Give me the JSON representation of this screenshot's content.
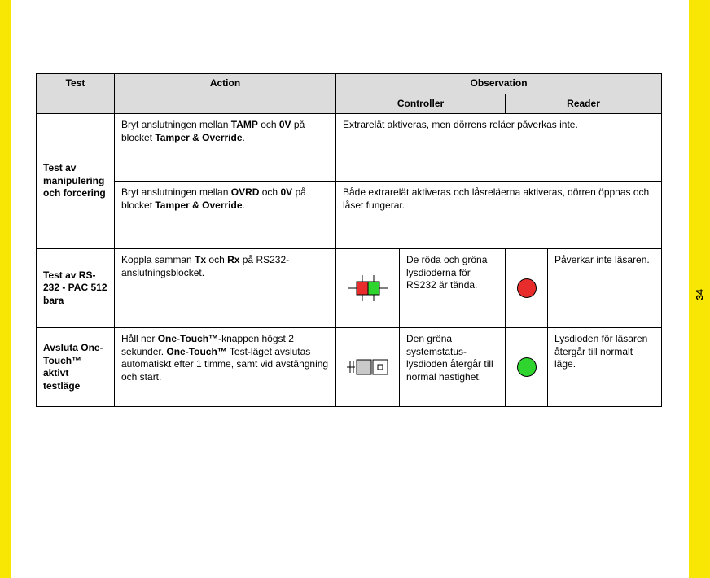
{
  "pageNumber": "34",
  "headers": {
    "test": "Test",
    "action": "Action",
    "observation": "Observation",
    "controller": "Controller",
    "reader": "Reader"
  },
  "rows": {
    "tamper": {
      "label": "Test av manipulering och forcering",
      "action1_pre": "Bryt anslutningen mellan ",
      "action1_b1": "TAMP",
      "action1_mid": " och ",
      "action1_b2": "0V",
      "action1_mid2": " på blocket ",
      "action1_b3": "Tamper & Override",
      "action1_post": ".",
      "obs1": "Extrarelät aktiveras, men dörrens reläer påverkas inte.",
      "action2_pre": "Bryt anslutningen mellan ",
      "action2_b1": "OVRD",
      "action2_mid": " och ",
      "action2_b2": "0V",
      "action2_mid2": " på blocket ",
      "action2_b3": "Tamper & Override",
      "action2_post": ".",
      "obs2": "Både extrarelät aktiveras och låsreläerna aktiveras, dörren öppnas och låset fungerar."
    },
    "rs232": {
      "label": "Test av RS-232 - PAC 512 bara",
      "action_pre": "Koppla samman ",
      "action_b1": "Tx",
      "action_mid": " och ",
      "action_b2": "Rx",
      "action_post": " på RS232-anslutningsblocket.",
      "ctrlText": "De röda och gröna lysdioderna för RS232 är tända.",
      "readerText": "Påverkar inte läsaren."
    },
    "onetouch": {
      "label": "Avsluta One-Touch™ aktivt testläge",
      "action_pre": "Håll ner ",
      "action_b1": "One-Touch™",
      "action_mid": "-knappen högst 2 sekunder. ",
      "action_b2": "One-Touch™",
      "action_post": " Test-läget avslutas automatiskt efter 1 timme, samt vid avstängning och start.",
      "ctrlText": "Den gröna systemstatus-lysdioden återgår till normal hastighet.",
      "readerText": "Lysdioden för läsaren återgår till normalt läge."
    }
  }
}
